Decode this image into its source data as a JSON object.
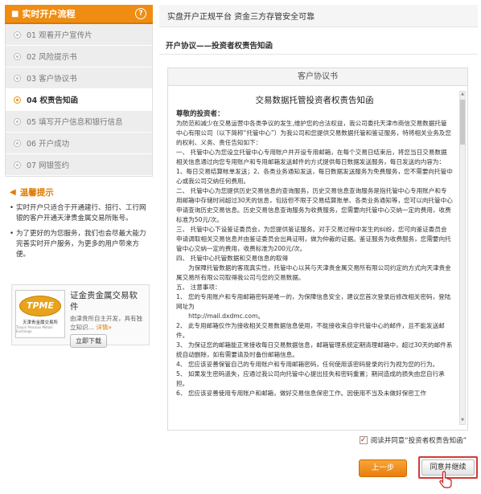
{
  "sidebar": {
    "title": "实时开户流程",
    "help_icon": "?",
    "steps": [
      {
        "label": "01 观看开户宣传片",
        "active": false
      },
      {
        "label": "02 风险提示书",
        "active": false
      },
      {
        "label": "03 客户协议书",
        "active": false
      },
      {
        "label": "04 权责告知函",
        "active": true
      },
      {
        "label": "05 填写开户信息和银行信息",
        "active": false
      },
      {
        "label": "06 开户成功",
        "active": false
      },
      {
        "label": "07 网银签约",
        "active": false
      }
    ],
    "tips_title": "温馨提示",
    "tips": [
      "实时开户只适合于开通建行、招行、工行网银的客户开通天津贵金属交易所账号。",
      "为了更好的为您服务，我们也会尽最大能力完善实时开户服务，为更多的用户带来方便。"
    ],
    "ad": {
      "logo_text": "TPME",
      "logo_cn": "天津贵金属交易所",
      "logo_en": "Tianjin Precious Metals Exchange",
      "title": "证金贵金属交易软件",
      "desc": "由津贵所自主开发，具有独立知识…",
      "more": "详情»",
      "button": "立即下载"
    }
  },
  "main": {
    "topbar": "实盘开户正规平台  资金三方存管安全可靠",
    "section_title": "开户协议——投资者权责告知函",
    "panel_title": "客户协议书",
    "doc_title": "交易数据托管投资者权责告知函",
    "salutation": "尊敬的投资者：",
    "paragraphs": [
      "为防范和减少在交易运营中各类争议的发生,维护您的合法权益，我公司委托天津市商信交易数据托管中心有限公司（以下简称“托管中心”）为我公司和您提供交易数据托管和鉴证服务，特将相关业务及您的权利、义务、责任告知如下：",
      "一、 托管中心为您设立托管中心专用账户并开设专用邮箱，在每个交易日结束后，将您当日交易数据相关信息通过向您专用账户和专用邮箱发送邮件的方式提供每日数据发送服务，每日发送的内容为：1、每日交易结算帐单发送；2、各类业务通知发送，每日数据发送服务为免费服务，您不需要向托管中心或我公司交纳任何费用。",
      "二、 托管中心为您提供历史交易信息的查询服务，历史交易信息查询服务是指托管中心专用账户和专用邮箱中存储时间超过30天的信息，包括但不限于交易结算账单、各类业务通知等，您可以向托管中心申请查询历史交易信息。历史交易信息查询服务为收费服务，您需要向托管中心交纳一定的费用，收费标准为50元/次。",
      "三、 托管中心下设鉴证委员会，为您提供鉴证服务。对于交易过程中发生的纠纷，您可向鉴证委员会申请调取相关交易信息并由鉴证委员会出具证明，做为仲裁的证据。鉴证服务为收费服务，您需要向托管中心交纳一定的费用，收费标准为200元/次。",
      "四、 托管中心托管数据和交易信息的取得",
      "　　为保障托管数据的客观真实性，托管中心以其与天津贵金属交易所有限公司约定的方式向天津贵金属交易所有限公司取得我公司与您的交易数据。",
      "五、 注意事项：",
      "1、 您的专用账户和专用邮箱密码是唯一的，为保障信息安全，建议您首次登录后修改相关密码，登陆网址为",
      "　　http://mail.dxdmc.com。",
      "2、 此专用邮箱仅作为接收相关交易数据信息使用，不能接收来自非托管中心的邮件，且不能发送邮件。",
      "3、 为保证您的邮箱能正常接收每日交易数据信息，邮箱管理系统定期清理邮箱中，超过30天的邮件系统自动删除，如有需要请及时备份邮箱信息。",
      "4、 您应该妥善保管自己的专用账户和专用邮箱密码，任何使用该密码登录的行为视为您的行为。",
      "5、 如果发生密码遗失，应通过我公司向托管中心提出挂失和密码重置；期间造成的损失由您自行承担。",
      "6、 您应该妥善使用专用账户和邮箱，做好交易信息保密工作。因使用不当及未做好保密工作"
    ],
    "agree_label": "阅读并同意“投资者权责告知函”",
    "agree_mark": "✓",
    "prev_button": "上一步",
    "next_button": "同意并继续"
  }
}
